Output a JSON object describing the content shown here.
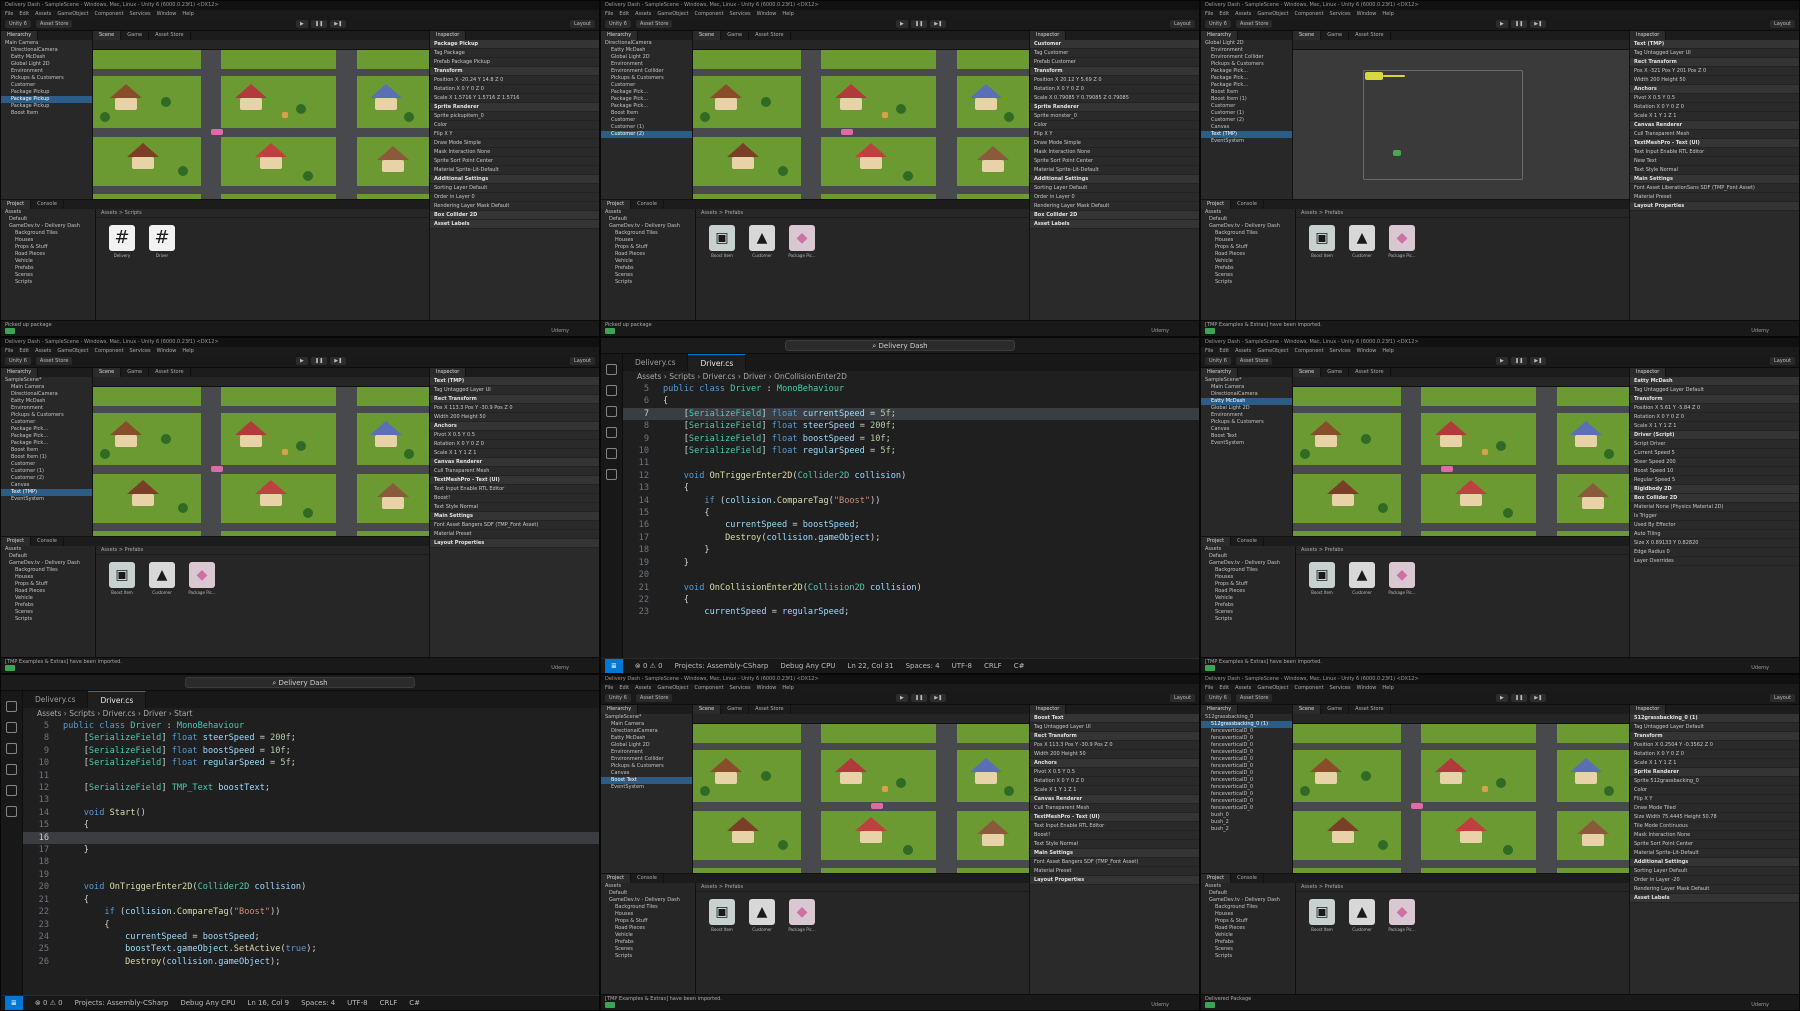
{
  "colors": {
    "unity_bg": "#1f1f1f",
    "vscode_accent": "#0078d4",
    "selection": "#2c5d87",
    "grass": "#6b9a33"
  },
  "unity": {
    "window_title": "Delivery Dash - SampleScene - Windows, Mac, Linux - Unity 6 (6000.0.23f1) <DX12>",
    "menu": [
      "File",
      "Edit",
      "Assets",
      "GameObject",
      "Component",
      "Services",
      "Window",
      "Help"
    ],
    "toolbar": {
      "version": "Unity 6",
      "asset_store": "Asset Store",
      "layout": "Layout"
    },
    "tabs": {
      "hierarchy": "Hierarchy",
      "scene": "Scene",
      "game": "Game",
      "asset_store": "Asset Store",
      "inspector": "Inspector",
      "project": "Project",
      "console": "Console"
    },
    "hierarchy_root": "SampleScene*",
    "project_tree": [
      "Assets",
      "Default",
      "GameDev.tv - Delivery Dash",
      "Background Tiles",
      "Houses",
      "Props & Stuff",
      "Road Pieces",
      "Vehicle",
      "Prefabs",
      "Scenes",
      "Scripts"
    ],
    "brand": "Udemy"
  },
  "panes": [
    {
      "hierarchy": [
        "Main Camera",
        "DirectionalCamera",
        "Eatty McDash",
        "Global Light 2D",
        "Environment",
        "Pickups & Customers",
        "Customer",
        "Package Pickup",
        "Package Pickup",
        "Package Pickup",
        "Boost Item"
      ],
      "selected": 8,
      "inspector_title": "Package Pickup",
      "inspector_rows": [
        "Tag  Package",
        "Prefab  Package Pickup",
        "Transform",
        "Position  X -20.24  Y 14.8  Z 0",
        "Rotation  X 0  Y 0  Z 0",
        "Scale  X 1.5716  Y 1.5716  Z 1.5716",
        "Sprite Renderer",
        "Sprite  pickupitem_0",
        "Color",
        "Flip  X  Y",
        "Draw Mode  Simple",
        "Mask Interaction  None",
        "Sprite Sort Point  Center",
        "Material  Sprite-Lit-Default",
        "Additional Settings",
        "Sorting Layer  Default",
        "Order in Layer  0",
        "Rendering Layer Mask  Default",
        "Box Collider 2D",
        "Asset Labels"
      ],
      "project_breadcrumb": "Assets > Scripts",
      "assets": [
        "Delivery",
        "Driver"
      ],
      "status": "Picked up package",
      "view": "game"
    },
    {
      "hierarchy": [
        "DirectionalCamera",
        "Eatty McDash",
        "Global Light 2D",
        "Environment",
        "Environment Collider",
        "Pickups & Customers",
        "Customer",
        "Package Pick...",
        "Package Pick...",
        "Package Pick...",
        "Boost Item",
        "Customer",
        "Customer (1)",
        "Customer (2)"
      ],
      "selected": 13,
      "inspector_title": "Customer",
      "inspector_rows": [
        "Tag  Customer",
        "Prefab  Customer",
        "Transform",
        "Position  X 20.12  Y 5.69  Z 0",
        "Rotation  X 0  Y 0  Z 0",
        "Scale  X 0.79085  Y 0.79085  Z 0.79085",
        "Sprite Renderer",
        "Sprite  monster_0",
        "Color",
        "Flip  X  Y",
        "Draw Mode  Simple",
        "Mask Interaction  None",
        "Sprite Sort Point  Center",
        "Material  Sprite-Lit-Default",
        "Additional Settings",
        "Sorting Layer  Default",
        "Order in Layer  0",
        "Rendering Layer Mask  Default",
        "Box Collider 2D",
        "Asset Labels"
      ],
      "project_breadcrumb": "Assets > Prefabs",
      "assets": [
        "Boost Item",
        "Customer",
        "Package Pic..."
      ],
      "status": "Picked up package",
      "view": "game"
    },
    {
      "hierarchy": [
        "Global Light 2D",
        "Environment",
        "Environment Collider",
        "Pickups & Customers",
        "Package Pick...",
        "Package Pick...",
        "Package Pick...",
        "Boost Item",
        "Boost Item (1)",
        "Customer",
        "Customer (1)",
        "Customer (2)",
        "Canvas",
        "Text (TMP)",
        "EventSystem"
      ],
      "selected": 13,
      "inspector_title": "Text (TMP)",
      "inspector_rows": [
        "Tag  Untagged  Layer  UI",
        "Rect Transform",
        "Pos X -321  Pos Y 201  Pos Z 0",
        "Width 200  Height 50",
        "Anchors",
        "Pivot  X 0.5  Y 0.5",
        "Rotation  X 0  Y 0  Z 0",
        "Scale  X 1  Y 1  Z 1",
        "Canvas Renderer",
        "Cull Transparent Mesh",
        "TextMeshPro - Text (UI)",
        "Text Input  Enable RTL Editor",
        "New Text",
        "Text Style  Normal",
        "Main Settings",
        "Font Asset  LiberationSans SDF (TMP_Font Asset)",
        "Material Preset",
        "Layout Properties"
      ],
      "project_breadcrumb": "Assets > Prefabs",
      "assets": [
        "Boost Item",
        "Customer",
        "Package Pic..."
      ],
      "status": "[TMP Examples & Extras] have been imported.",
      "view": "empty"
    },
    {
      "hierarchy": [
        "SampleScene*",
        "Main Camera",
        "DirectionalCamera",
        "Eatty McDash",
        "Environment",
        "Pickups & Customers",
        "Customer",
        "Package Pick...",
        "Package Pick...",
        "Package Pick...",
        "Boost Item",
        "Boost Item (1)",
        "Customer",
        "Customer (1)",
        "Customer (2)",
        "Canvas",
        "Text (TMP)",
        "EventSystem"
      ],
      "selected": 16,
      "inspector_title": "Text (TMP)",
      "inspector_rows": [
        "Tag  Untagged  Layer  UI",
        "Rect Transform",
        "Pos X 113.3  Pos Y -30.9  Pos Z 0",
        "Width 200  Height 50",
        "Anchors",
        "Pivot  X 0.5  Y 0.5",
        "Rotation  X 0  Y 0  Z 0",
        "Scale  X 1  Y 1  Z 1",
        "Canvas Renderer",
        "Cull Transparent Mesh",
        "TextMeshPro - Text (UI)",
        "Text Input  Enable RTL Editor",
        "Boost!",
        "Text Style  Normal",
        "Main Settings",
        "Font Asset  Bangers SDF (TMP_Font Asset)",
        "Material Preset",
        "Layout Properties"
      ],
      "project_breadcrumb": "Assets > Prefabs",
      "assets": [
        "Boost Item",
        "Customer",
        "Package Pic..."
      ],
      "status": "[TMP Examples & Extras] have been imported.",
      "view": "game"
    },
    {
      "hierarchy": [
        "SampleScene*",
        "Main Camera",
        "DirectionalCamera",
        "Eatty McDash",
        "Global Light 2D",
        "Environment",
        "Pickups & Customers",
        "Canvas",
        "Boost Text",
        "EventSystem"
      ],
      "selected": 3,
      "inspector_title": "Eatty McDash",
      "inspector_rows": [
        "Tag  Untagged  Layer  Default",
        "Transform",
        "Position  X 5.61  Y -5.84  Z 0",
        "Rotation  X 0  Y 0  Z 0",
        "Scale  X 1  Y 1  Z 1",
        "Driver (Script)",
        "Script  Driver",
        "Current Speed  5",
        "Steer Speed  200",
        "Boost Speed  10",
        "Regular Speed  5",
        "Rigidbody 2D",
        "Box Collider 2D",
        "Material  None (Physics Material 2D)",
        "Is Trigger",
        "Used By Effector",
        "Auto Tiling",
        "Size  X 0.89133  Y 0.82820",
        "Edge Radius  0",
        "Layer Overrides"
      ],
      "project_breadcrumb": "Assets > Prefabs",
      "assets": [
        "Boost Item",
        "Customer",
        "Package Pic..."
      ],
      "status": "[TMP Examples & Extras] have been imported.",
      "view": "game"
    },
    {
      "hierarchy": [
        "SampleScene*",
        "Main Camera",
        "DirectionalCamera",
        "Eatty McDash",
        "Global Light 2D",
        "Environment",
        "Environment Collider",
        "Pickups & Customers",
        "Canvas",
        "Boost Text",
        "EventSystem"
      ],
      "selected": 9,
      "inspector_title": "Boost Text",
      "inspector_rows": [
        "Tag  Untagged  Layer  UI",
        "Rect Transform",
        "Pos X 113.3  Pos Y -30.9  Pos Z 0",
        "Width 200  Height 50",
        "Anchors",
        "Pivot  X 0.5  Y 0.5",
        "Rotation  X 0  Y 0  Z 0",
        "Scale  X 1  Y 1  Z 1",
        "Canvas Renderer",
        "Cull Transparent Mesh",
        "TextMeshPro - Text (UI)",
        "Text Input  Enable RTL Editor",
        "Boost!",
        "Text Style  Normal",
        "Main Settings",
        "Font Asset  Bangers SDF (TMP_Font Asset)",
        "Material Preset",
        "Layout Properties"
      ],
      "project_breadcrumb": "Assets > Prefabs",
      "assets": [
        "Boost Item",
        "Customer",
        "Package Pic..."
      ],
      "status": "[TMP Examples & Extras] have been imported.",
      "view": "game"
    },
    {
      "hierarchy": [
        "512grassbacking_0",
        "512grassbacking_0 (1)",
        "fenceverticalD_0",
        "fenceverticalD_0",
        "fenceverticalD_0",
        "fenceverticalD_0",
        "fenceverticalD_0",
        "fenceverticalD_0",
        "fenceverticalD_0",
        "fenceverticalD_0",
        "fenceverticalD_0",
        "fenceverticalD_0",
        "fenceverticalD_0",
        "fenceverticalD_0",
        "bush_0",
        "bush_2",
        "bush_2"
      ],
      "selected": 1,
      "inspector_title": "512grassbacking_0 (1)",
      "inspector_rows": [
        "Tag  Untagged  Layer  Default",
        "Transform",
        "Position  X 0.2504  Y -0.3562  Z 0",
        "Rotation  X 0  Y 0  Z 0",
        "Scale  X 1  Y 1  Z 1",
        "Sprite Renderer",
        "Sprite  512grassbacking_0",
        "Color",
        "Flip  X  Y",
        "Draw Mode  Tiled",
        "Size  Width 75.4445  Height 50.78",
        "Tile Mode  Continuous",
        "Mask Interaction  None",
        "Sprite Sort Point  Center",
        "Material  Sprite-Lit-Default",
        "Additional Settings",
        "Sorting Layer  Default",
        "Order in Layer  -20",
        "Rendering Layer Mask  Default",
        "Asset Labels"
      ],
      "project_breadcrumb": "Assets > Prefabs",
      "assets": [
        "Boost Item",
        "Customer",
        "Package Pic..."
      ],
      "status": "Delivered Package",
      "view": "game"
    }
  ],
  "vscode": [
    {
      "search": "Delivery Dash",
      "tabs": [
        "Delivery.cs",
        "Driver.cs"
      ],
      "active_tab": 1,
      "breadcrumb": [
        "Assets",
        "Scripts",
        "Driver.cs",
        "Driver",
        "OnCollisionEnter2D"
      ],
      "status": {
        "errors": "0",
        "warnings": "0",
        "project": "Projects: Assembly-CSharp",
        "config": "Debug Any CPU",
        "position": "Ln 22, Col 31",
        "spaces": "Spaces: 4",
        "encoding": "UTF-8",
        "eol": "CRLF",
        "language": "C#"
      },
      "lines": [
        {
          "n": "5",
          "text": "public class Driver : MonoBehaviour"
        },
        {
          "n": "6",
          "text": "{"
        },
        {
          "n": "7",
          "text": "    [SerializeField] float currentSpeed = 5f;"
        },
        {
          "n": "8",
          "text": "    [SerializeField] float steerSpeed = 200f;"
        },
        {
          "n": "9",
          "text": "    [SerializeField] float boostSpeed = 10f;"
        },
        {
          "n": "10",
          "text": "    [SerializeField] float regularSpeed = 5f;"
        },
        {
          "n": "11",
          "text": ""
        },
        {
          "n": "12",
          "text": "    void OnTriggerEnter2D(Collider2D collision)"
        },
        {
          "n": "13",
          "text": "    {"
        },
        {
          "n": "14",
          "text": "        if (collision.CompareTag(\"Boost\"))"
        },
        {
          "n": "15",
          "text": "        {"
        },
        {
          "n": "16",
          "text": "            currentSpeed = boostSpeed;"
        },
        {
          "n": "17",
          "text": "            Destroy(collision.gameObject);"
        },
        {
          "n": "18",
          "text": "        }"
        },
        {
          "n": "19",
          "text": "    }"
        },
        {
          "n": "20",
          "text": ""
        },
        {
          "n": "21",
          "text": "    void OnCollisionEnter2D(Collision2D collision)"
        },
        {
          "n": "22",
          "text": "    {"
        },
        {
          "n": "23",
          "text": "        currentSpeed = regularSpeed;"
        }
      ],
      "current_line": 2
    },
    {
      "search": "Delivery Dash",
      "tabs": [
        "Delivery.cs",
        "Driver.cs"
      ],
      "active_tab": 1,
      "breadcrumb": [
        "Assets",
        "Scripts",
        "Driver.cs",
        "Driver",
        "Start"
      ],
      "status": {
        "errors": "0",
        "warnings": "0",
        "project": "Projects: Assembly-CSharp",
        "config": "Debug Any CPU",
        "position": "Ln 16, Col 9",
        "spaces": "Spaces: 4",
        "encoding": "UTF-8",
        "eol": "CRLF",
        "language": "C#"
      },
      "lines": [
        {
          "n": "5",
          "text": "public class Driver : MonoBehaviour"
        },
        {
          "n": "8",
          "text": "    [SerializeField] float steerSpeed = 200f;"
        },
        {
          "n": "9",
          "text": "    [SerializeField] float boostSpeed = 10f;"
        },
        {
          "n": "10",
          "text": "    [SerializeField] float regularSpeed = 5f;"
        },
        {
          "n": "11",
          "text": ""
        },
        {
          "n": "12",
          "text": "    [SerializeField] TMP_Text boostText;"
        },
        {
          "n": "13",
          "text": ""
        },
        {
          "n": "14",
          "text": "    void Start()"
        },
        {
          "n": "15",
          "text": "    {"
        },
        {
          "n": "16",
          "text": "        "
        },
        {
          "n": "17",
          "text": "    }"
        },
        {
          "n": "18",
          "text": ""
        },
        {
          "n": "19",
          "text": ""
        },
        {
          "n": "20",
          "text": "    void OnTriggerEnter2D(Collider2D collision)"
        },
        {
          "n": "21",
          "text": "    {"
        },
        {
          "n": "22",
          "text": "        if (collision.CompareTag(\"Boost\"))"
        },
        {
          "n": "23",
          "text": "        {"
        },
        {
          "n": "24",
          "text": "            currentSpeed = boostSpeed;"
        },
        {
          "n": "25",
          "text": "            boostText.gameObject.SetActive(true);"
        },
        {
          "n": "26",
          "text": "            Destroy(collision.gameObject);"
        }
      ],
      "current_line": 9
    }
  ]
}
